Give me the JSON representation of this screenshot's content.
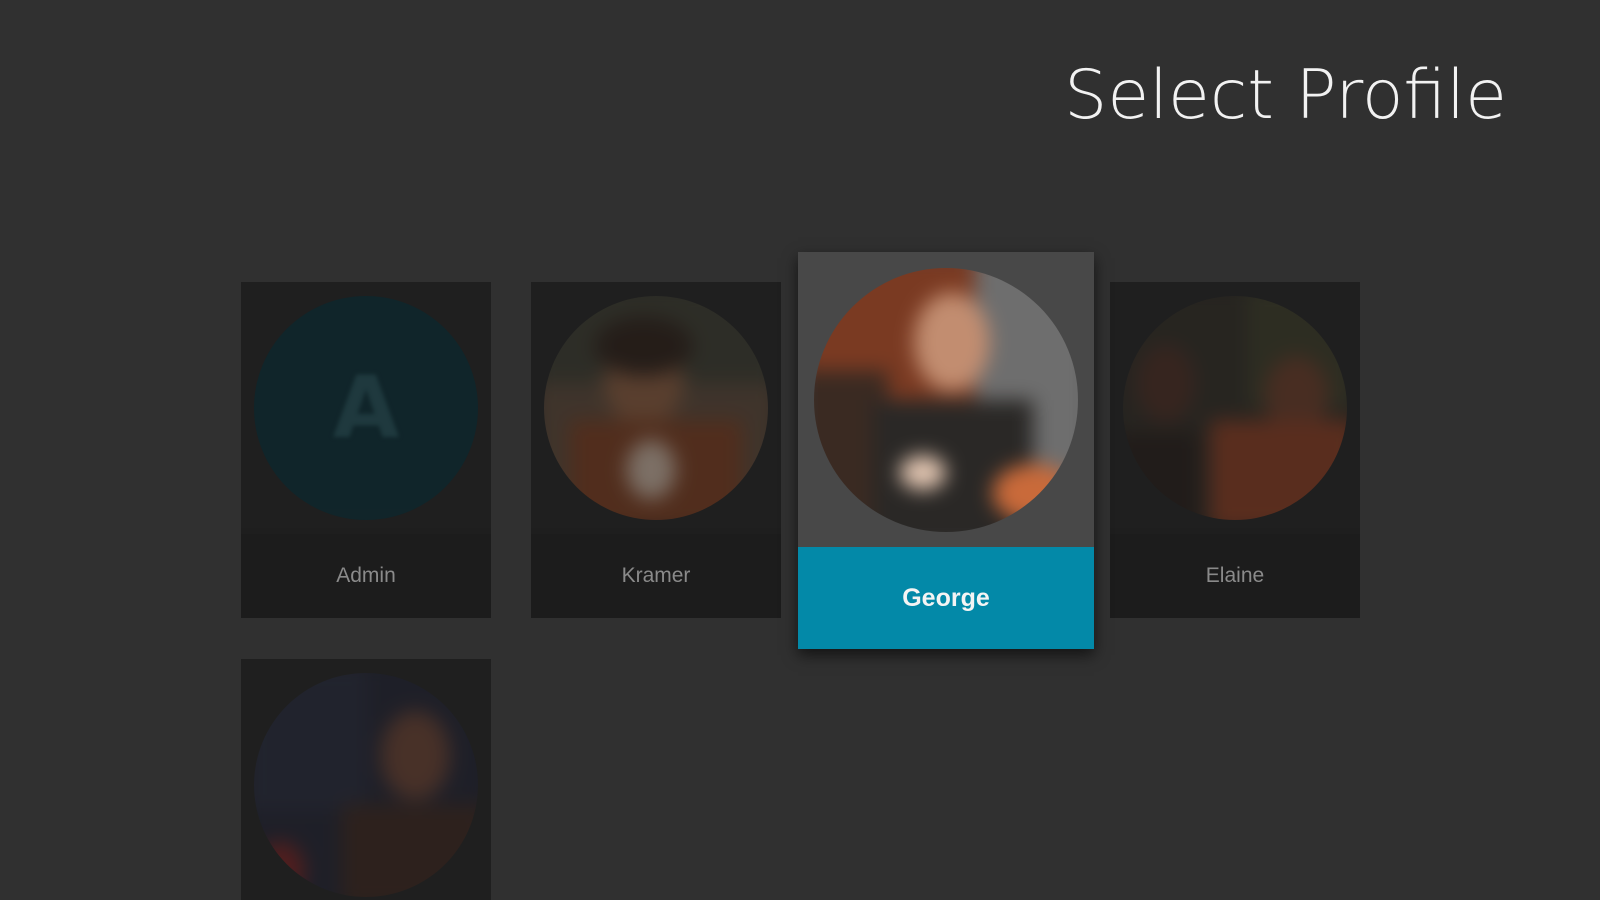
{
  "header": {
    "title": "Select Profile"
  },
  "profiles": [
    {
      "name": "Admin",
      "initial": "A",
      "avatar_type": "initial",
      "avatar_color": "#052a33"
    },
    {
      "name": "Kramer",
      "avatar_type": "photo"
    },
    {
      "name": "George",
      "avatar_type": "photo",
      "selected": true
    },
    {
      "name": "Elaine",
      "avatar_type": "photo"
    },
    {
      "name": "",
      "avatar_type": "photo"
    }
  ],
  "colors": {
    "background": "#303030",
    "card": "#1e1e1e",
    "selected_card": "#484848",
    "selected_label_bg": "#0389a8",
    "title_text": "#f2f2f2"
  }
}
